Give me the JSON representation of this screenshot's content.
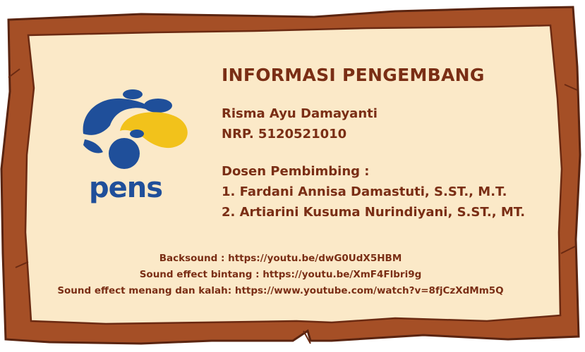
{
  "panel": {
    "title": "INFORMASI PENGEMBANG",
    "developer": {
      "name": "Risma Ayu Damayanti",
      "id": "NRP. 5120521010"
    },
    "supervisors": {
      "heading": "Dosen Pembimbing :",
      "items": [
        "1. Fardani Annisa Damastuti, S.ST., M.T.",
        "2. Artiarini Kusuma Nurindiyani, S.ST., MT."
      ]
    },
    "credits": [
      "Backsound : https://youtu.be/dwG0UdX5HBM",
      "Sound effect bintang : https://youtu.be/XmF4Flbri9g",
      "Sound effect menang dan kalah: https://www.youtube.com/watch?v=8fjCzXdMm5Q"
    ]
  },
  "logo": {
    "text": "PENS",
    "colors": {
      "blue": "#1f4f9a",
      "yellow": "#f2c21b"
    }
  },
  "colors": {
    "board_fill": "#fbe9c8",
    "board_border": "#9a4a22",
    "text": "#7a2e15"
  }
}
